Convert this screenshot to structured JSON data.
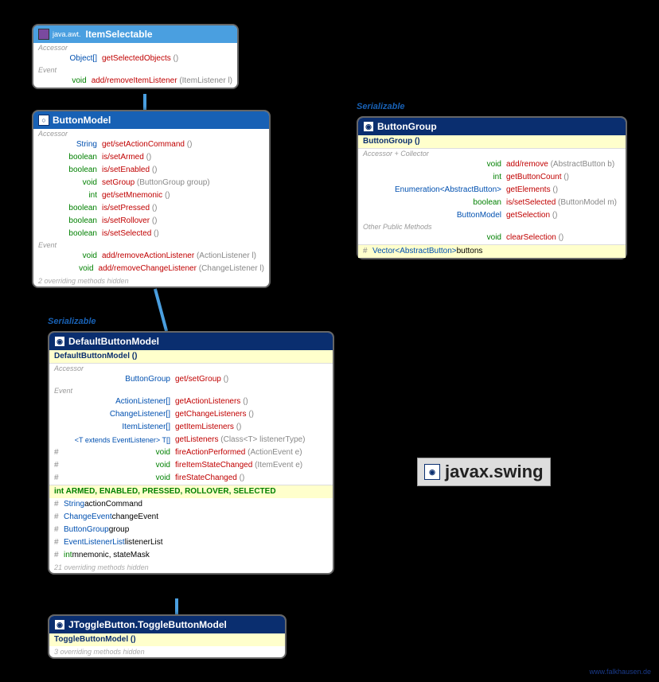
{
  "itemSelectable": {
    "pkg": "java.awt.",
    "name": "ItemSelectable",
    "sections": {
      "accessor": "Accessor",
      "event": "Event"
    },
    "accessor": [
      {
        "ret": "Object[]",
        "method": "getSelectedObjects",
        "params": "()"
      }
    ],
    "event": [
      {
        "ret": "void",
        "method": "add/removeItemListener",
        "params": "(ItemListener l)"
      }
    ]
  },
  "buttonModel": {
    "name": "ButtonModel",
    "sections": {
      "accessor": "Accessor",
      "event": "Event"
    },
    "accessor": [
      {
        "ret": "String",
        "method": "get/setActionCommand",
        "params": "()"
      },
      {
        "ret": "boolean",
        "method": "is/setArmed",
        "params": "()"
      },
      {
        "ret": "boolean",
        "method": "is/setEnabled",
        "params": "()"
      },
      {
        "ret": "void",
        "method": "setGroup",
        "params": "(ButtonGroup group)"
      },
      {
        "ret": "int",
        "method": "get/setMnemonic",
        "params": "()"
      },
      {
        "ret": "boolean",
        "method": "is/setPressed",
        "params": "()"
      },
      {
        "ret": "boolean",
        "method": "is/setRollover",
        "params": "()"
      },
      {
        "ret": "boolean",
        "method": "is/setSelected",
        "params": "()"
      }
    ],
    "event": [
      {
        "ret": "void",
        "method": "add/removeActionListener",
        "params": "(ActionListener l)"
      },
      {
        "ret": "void",
        "method": "add/removeChangeListener",
        "params": "(ChangeListener l)"
      }
    ],
    "hidden": "2 overriding methods hidden"
  },
  "stereoSerializable1": "Serializable",
  "defaultButtonModel": {
    "name": "DefaultButtonModel",
    "ctor": "DefaultButtonModel ()",
    "sections": {
      "accessor": "Accessor",
      "event": "Event"
    },
    "accessor": [
      {
        "ret": "ButtonGroup",
        "method": "get/setGroup",
        "params": "()"
      }
    ],
    "event": [
      {
        "vis": "",
        "ret": "ActionListener[]",
        "method": "getActionListeners",
        "params": "()"
      },
      {
        "vis": "",
        "ret": "ChangeListener[]",
        "method": "getChangeListeners",
        "params": "()"
      },
      {
        "vis": "",
        "ret": "ItemListener[]",
        "method": "getItemListeners",
        "params": "()"
      },
      {
        "vis": "",
        "ret": "<T extends EventListener> T[]",
        "method": "getListeners",
        "params": "(Class<T> listenerType)"
      },
      {
        "vis": "#",
        "ret": "void",
        "method": "fireActionPerformed",
        "params": "(ActionEvent e)"
      },
      {
        "vis": "#",
        "ret": "void",
        "method": "fireItemStateChanged",
        "params": "(ItemEvent e)"
      },
      {
        "vis": "#",
        "ret": "void",
        "method": "fireStateChanged",
        "params": "()"
      }
    ],
    "constants": "int ARMED, ENABLED, PRESSED, ROLLOVER, SELECTED",
    "fields": [
      {
        "vis": "#",
        "type": "String",
        "name": "actionCommand"
      },
      {
        "vis": "#",
        "type": "ChangeEvent",
        "name": "changeEvent"
      },
      {
        "vis": "#",
        "type": "ButtonGroup",
        "name": "group"
      },
      {
        "vis": "#",
        "type": "EventListenerList",
        "name": "listenerList"
      },
      {
        "vis": "#",
        "type": "int",
        "name": "mnemonic, stateMask"
      }
    ],
    "hidden": "21 overriding methods hidden"
  },
  "toggleModel": {
    "name": "JToggleButton.ToggleButtonModel",
    "ctor": "ToggleButtonModel ()",
    "hidden": "3 overriding methods hidden"
  },
  "stereoSerializable2": "Serializable",
  "buttonGroup": {
    "name": "ButtonGroup",
    "ctor": "ButtonGroup ()",
    "sections": {
      "accCollector": "Accessor + Collector",
      "other": "Other Public Methods"
    },
    "accCollector": [
      {
        "ret": "void",
        "method": "add/remove",
        "params": "(AbstractButton b)"
      },
      {
        "ret": "int",
        "method": "getButtonCount",
        "params": "()"
      },
      {
        "ret": "Enumeration<AbstractButton>",
        "method": "getElements",
        "params": "()"
      },
      {
        "ret": "boolean",
        "method": "is/setSelected",
        "params": "(ButtonModel m)"
      },
      {
        "ret": "ButtonModel",
        "method": "getSelection",
        "params": "()"
      }
    ],
    "other": [
      {
        "ret": "void",
        "method": "clearSelection",
        "params": "()"
      }
    ],
    "field": {
      "vis": "#",
      "type": "Vector<AbstractButton>",
      "name": "buttons"
    }
  },
  "packageTitle": "javax.swing",
  "watermark": "www.falkhausen.de"
}
